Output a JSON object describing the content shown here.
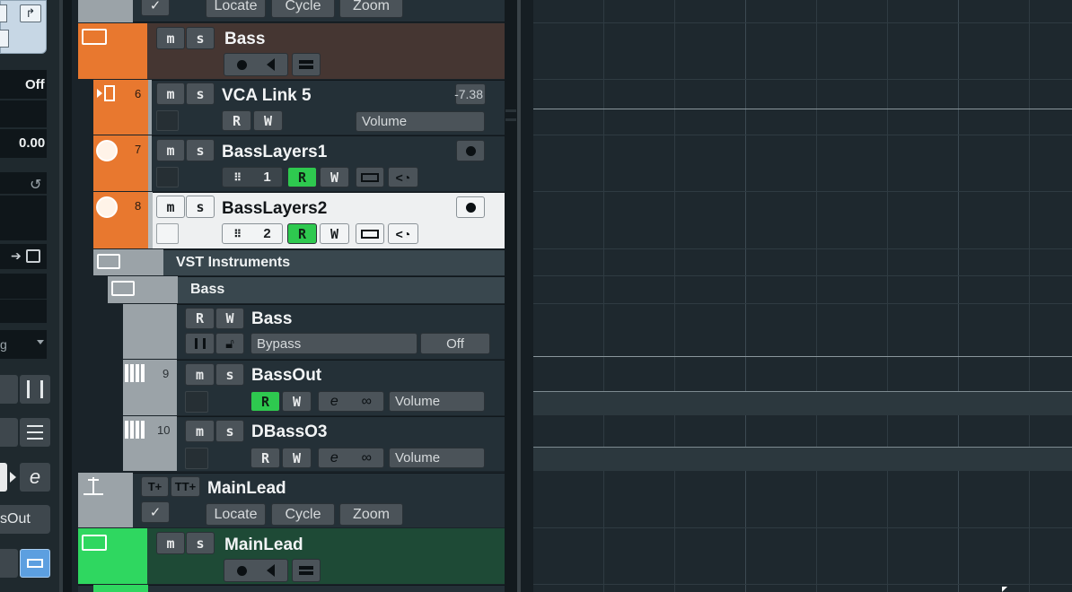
{
  "left_panel": {
    "off_value": "Off",
    "value_display": "0.00",
    "dropdown_text": "g",
    "out_button_label": "sOut"
  },
  "tracks": {
    "top_folder": {
      "check_icon": "checkmark-icon",
      "locate": "Locate",
      "cycle": "Cycle",
      "zoom": "Zoom"
    },
    "bass_folder": {
      "name": "Bass",
      "m": "M",
      "s": "S",
      "color": "#e8782f"
    },
    "vca": {
      "num": "6",
      "name": "VCA Link 5",
      "value": "-7.38",
      "r": "R",
      "w": "W",
      "param": "Volume"
    },
    "basslayers1": {
      "num": "7",
      "name": "BassLayers1",
      "channel": "1",
      "r": "R",
      "w": "W"
    },
    "basslayers2": {
      "num": "8",
      "name": "BassLayers2",
      "channel": "2",
      "r": "R",
      "w": "W"
    },
    "vst_folder": {
      "name": "VST Instruments"
    },
    "vst_bass_folder": {
      "name": "Bass"
    },
    "vst_bass": {
      "name": "Bass",
      "r": "R",
      "w": "W",
      "param": "Bypass",
      "param_value": "Off"
    },
    "bassout": {
      "num": "9",
      "name": "BassOut",
      "r": "R",
      "w": "W",
      "param": "Volume"
    },
    "dbasso3": {
      "num": "10",
      "name": "DBassO3",
      "r": "R",
      "w": "W",
      "param": "Volume"
    },
    "mainlead_marker": {
      "name": "MainLead",
      "locate": "Locate",
      "cycle": "Cycle",
      "zoom": "Zoom"
    },
    "mainlead_folder": {
      "name": "MainLead",
      "color": "#2fd760"
    }
  },
  "colors": {
    "accent_green": "#2ec94f",
    "folder_orange": "#e8782f",
    "folder_green": "#2fd760",
    "selected_track_bg": "#eef0f1"
  }
}
